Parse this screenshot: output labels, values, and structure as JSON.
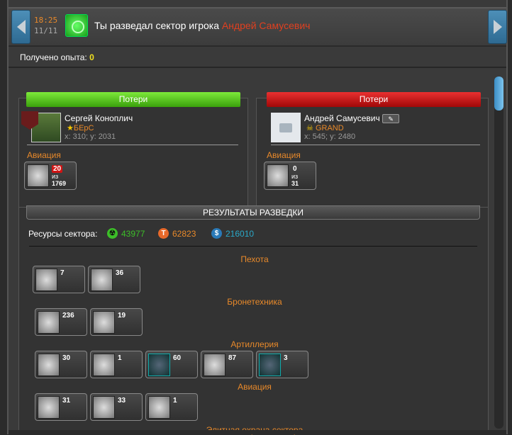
{
  "header": {
    "time": "18:25",
    "date": "11/11",
    "title_prefix": "Ты разведал сектор игрока",
    "title_player": "Андрей Самусевич"
  },
  "experience": {
    "label": "Получено опыта:",
    "value": "0"
  },
  "left_panel": {
    "bar_label": "Потери",
    "bar_color": "#4cc41a",
    "player_name": "Сергей Коноплич",
    "alliance": "БЕрС",
    "coords": "x: 310; y: 2031",
    "category": "Авиация",
    "unit": {
      "lost": "20",
      "of_label": "из",
      "total": "1769"
    }
  },
  "right_panel": {
    "bar_label": "Потери",
    "bar_color": "#d01414",
    "player_name": "Андрей Самусевич",
    "alliance": "GRAND",
    "coords": "x: 545; y: 2480",
    "category": "Авиация",
    "unit": {
      "lost": "0",
      "of_label": "из",
      "total": "31"
    }
  },
  "results": {
    "title": "РЕЗУЛЬТАТЫ РАЗВЕДКИ",
    "resources_label": "Ресурсы сектора:",
    "resources": [
      {
        "icon": "radiation-icon",
        "value": "43977",
        "color": "#3cbf28"
      },
      {
        "icon": "titanium-icon",
        "value": "62823",
        "color": "#e8892a"
      },
      {
        "icon": "dollar-icon",
        "value": "216010",
        "color": "#2aa8c8"
      }
    ],
    "categories": [
      {
        "name": "Пехота",
        "units": [
          "7",
          "36"
        ]
      },
      {
        "name": "Бронетехника",
        "units": [
          "236",
          "19"
        ]
      },
      {
        "name": "Артиллерия",
        "units": [
          "30",
          "1",
          "60",
          "87",
          "3"
        ]
      },
      {
        "name": "Авиация",
        "units": [
          "31",
          "33",
          "1"
        ]
      }
    ],
    "next_category": "Элитная охрана сектора"
  }
}
